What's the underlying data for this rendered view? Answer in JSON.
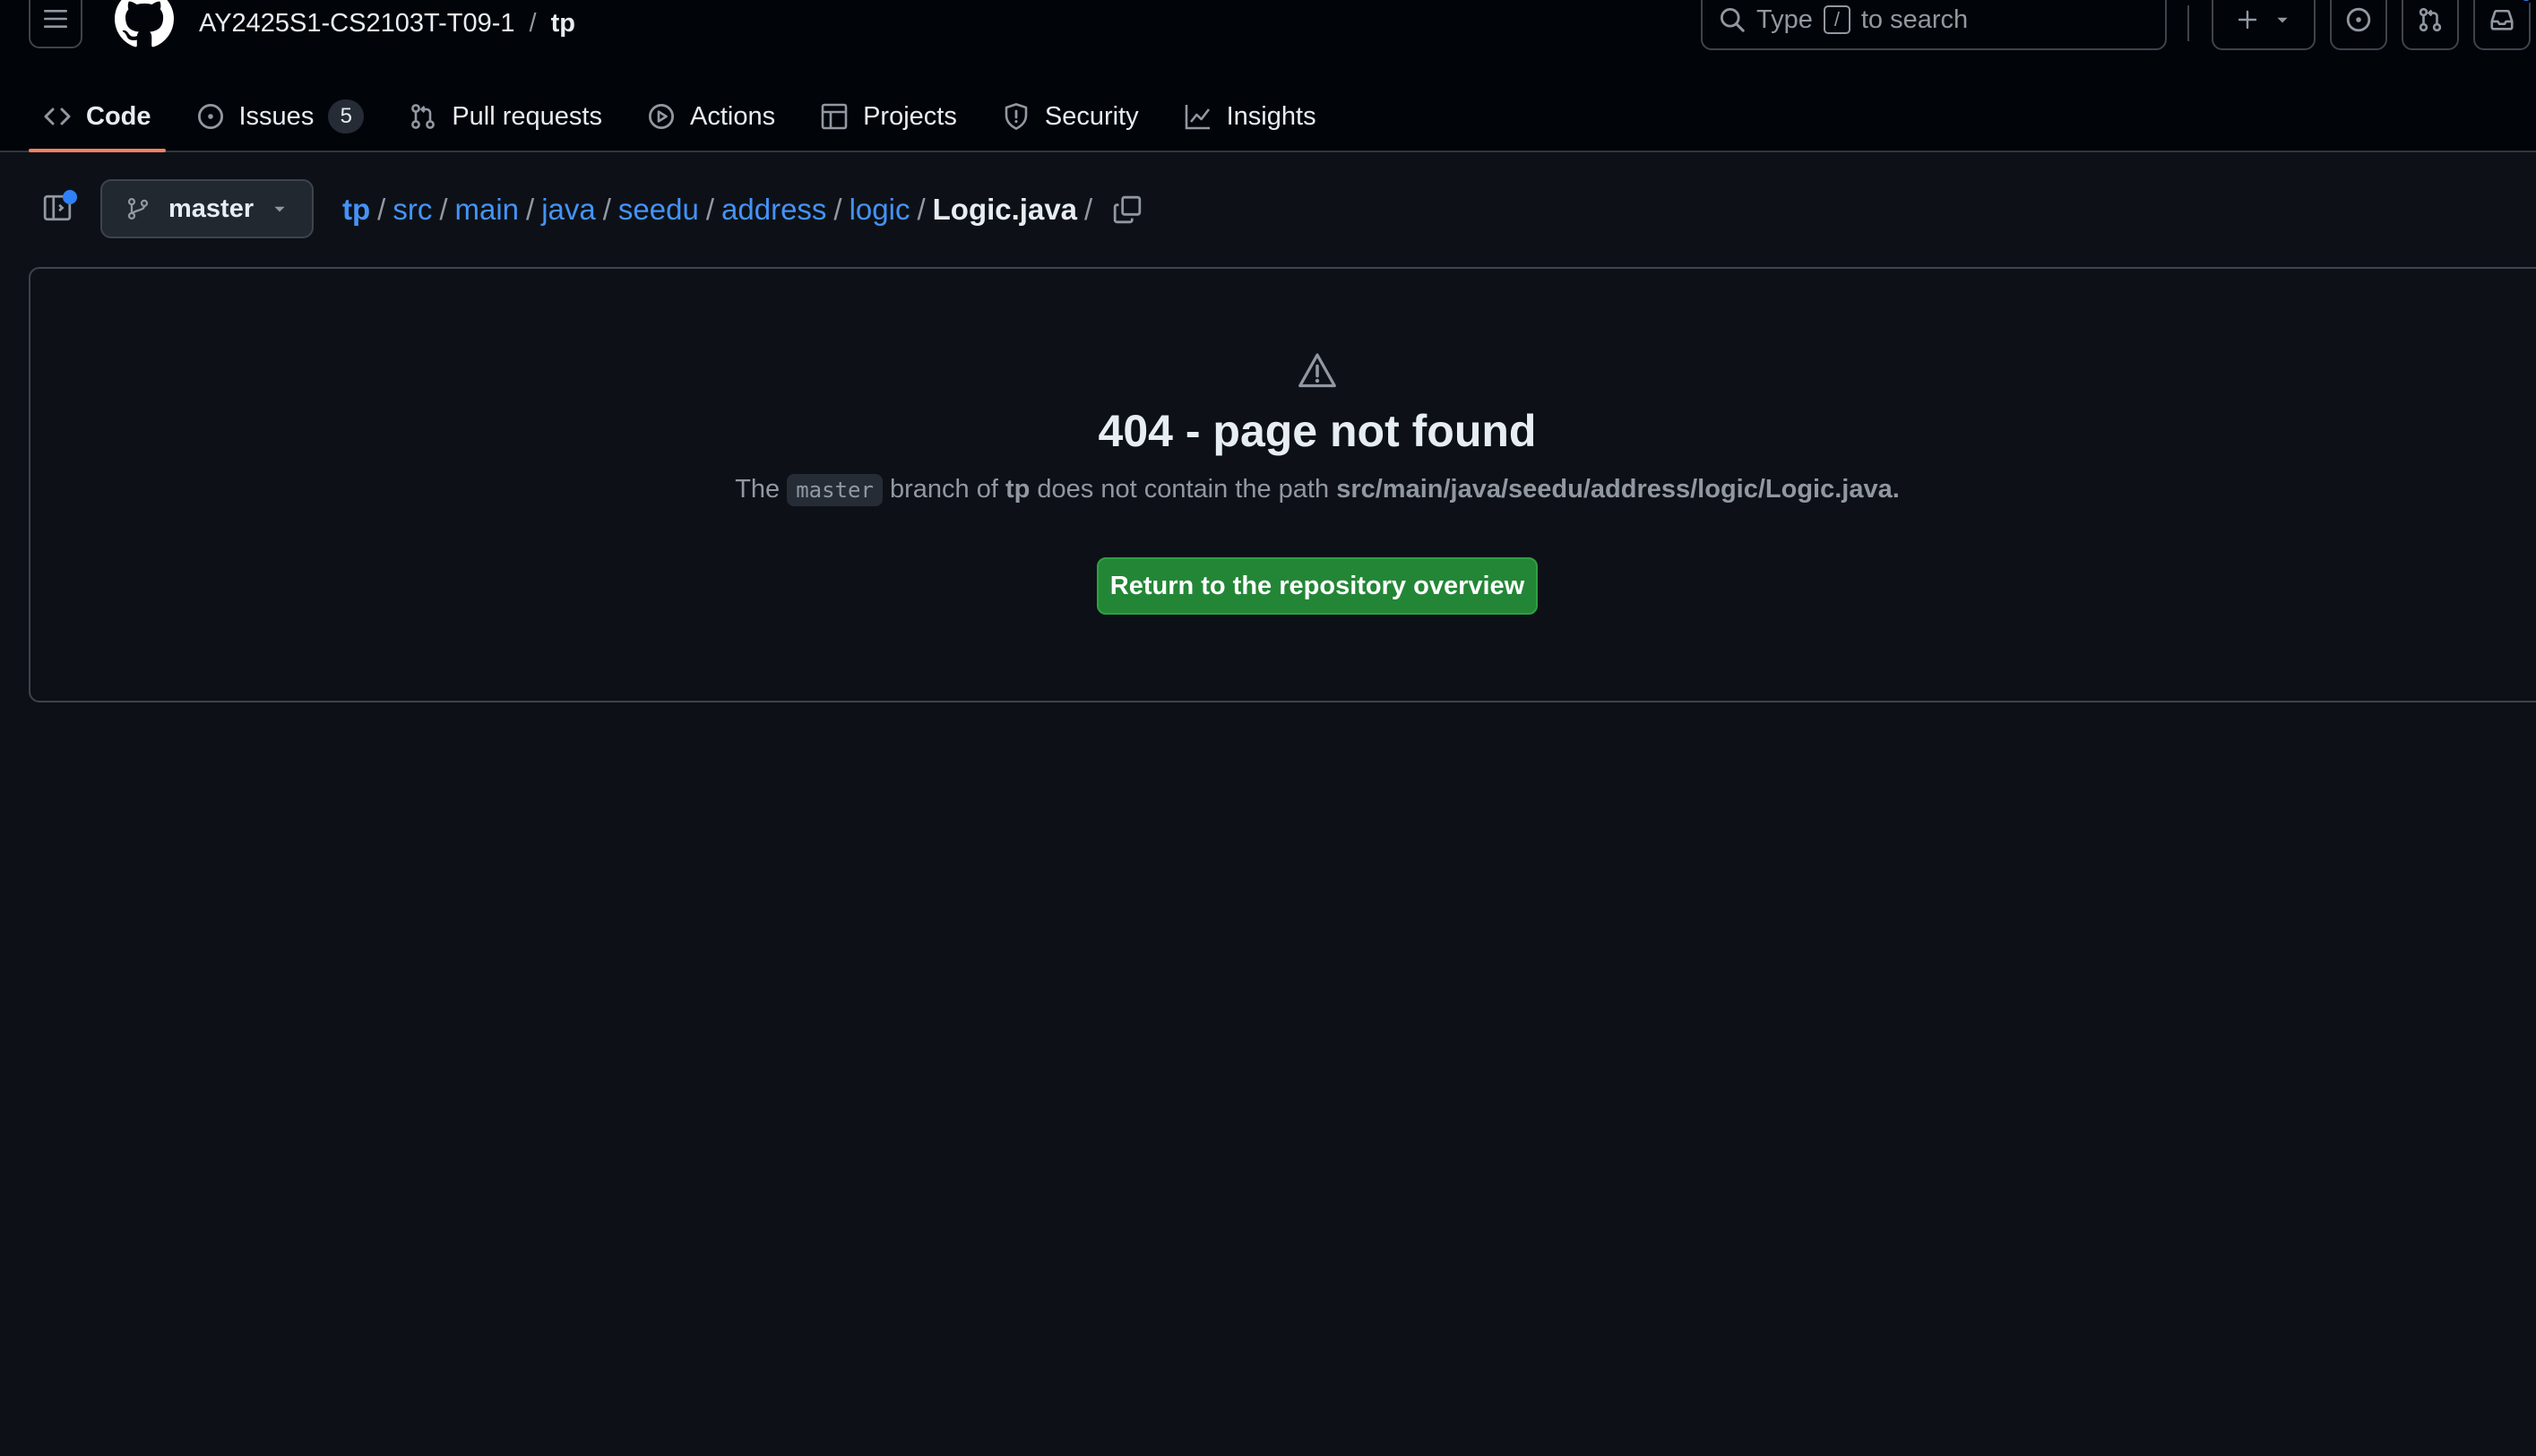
{
  "header": {
    "owner": "AY2425S1-CS2103T-T09-1",
    "separator": "/",
    "repo": "tp",
    "search": {
      "before": "Type",
      "key": "/",
      "after": "to search"
    }
  },
  "nav": {
    "tabs": [
      {
        "label": "Code",
        "active": true
      },
      {
        "label": "Issues",
        "counter": "5"
      },
      {
        "label": "Pull requests"
      },
      {
        "label": "Actions"
      },
      {
        "label": "Projects"
      },
      {
        "label": "Security"
      },
      {
        "label": "Insights"
      }
    ]
  },
  "breadcrumb": {
    "branch": "master",
    "segments": [
      "tp",
      "src",
      "main",
      "java",
      "seedu",
      "address",
      "logic"
    ],
    "file": "Logic.java",
    "separator": "/"
  },
  "error": {
    "title": "404 - page not found",
    "msg_the": "The",
    "msg_branch": "master",
    "msg_branch_of": "branch of",
    "msg_repo": "tp",
    "msg_not_contain": "does not contain the path",
    "msg_path": "src/main/java/seedu/address/logic/Logic.java.",
    "button": "Return to the repository overview"
  },
  "colors": {
    "background": "#0d1117",
    "header": "#010409",
    "link": "#4493f8",
    "active_underline": "#f78166",
    "button_green": "#238636"
  }
}
